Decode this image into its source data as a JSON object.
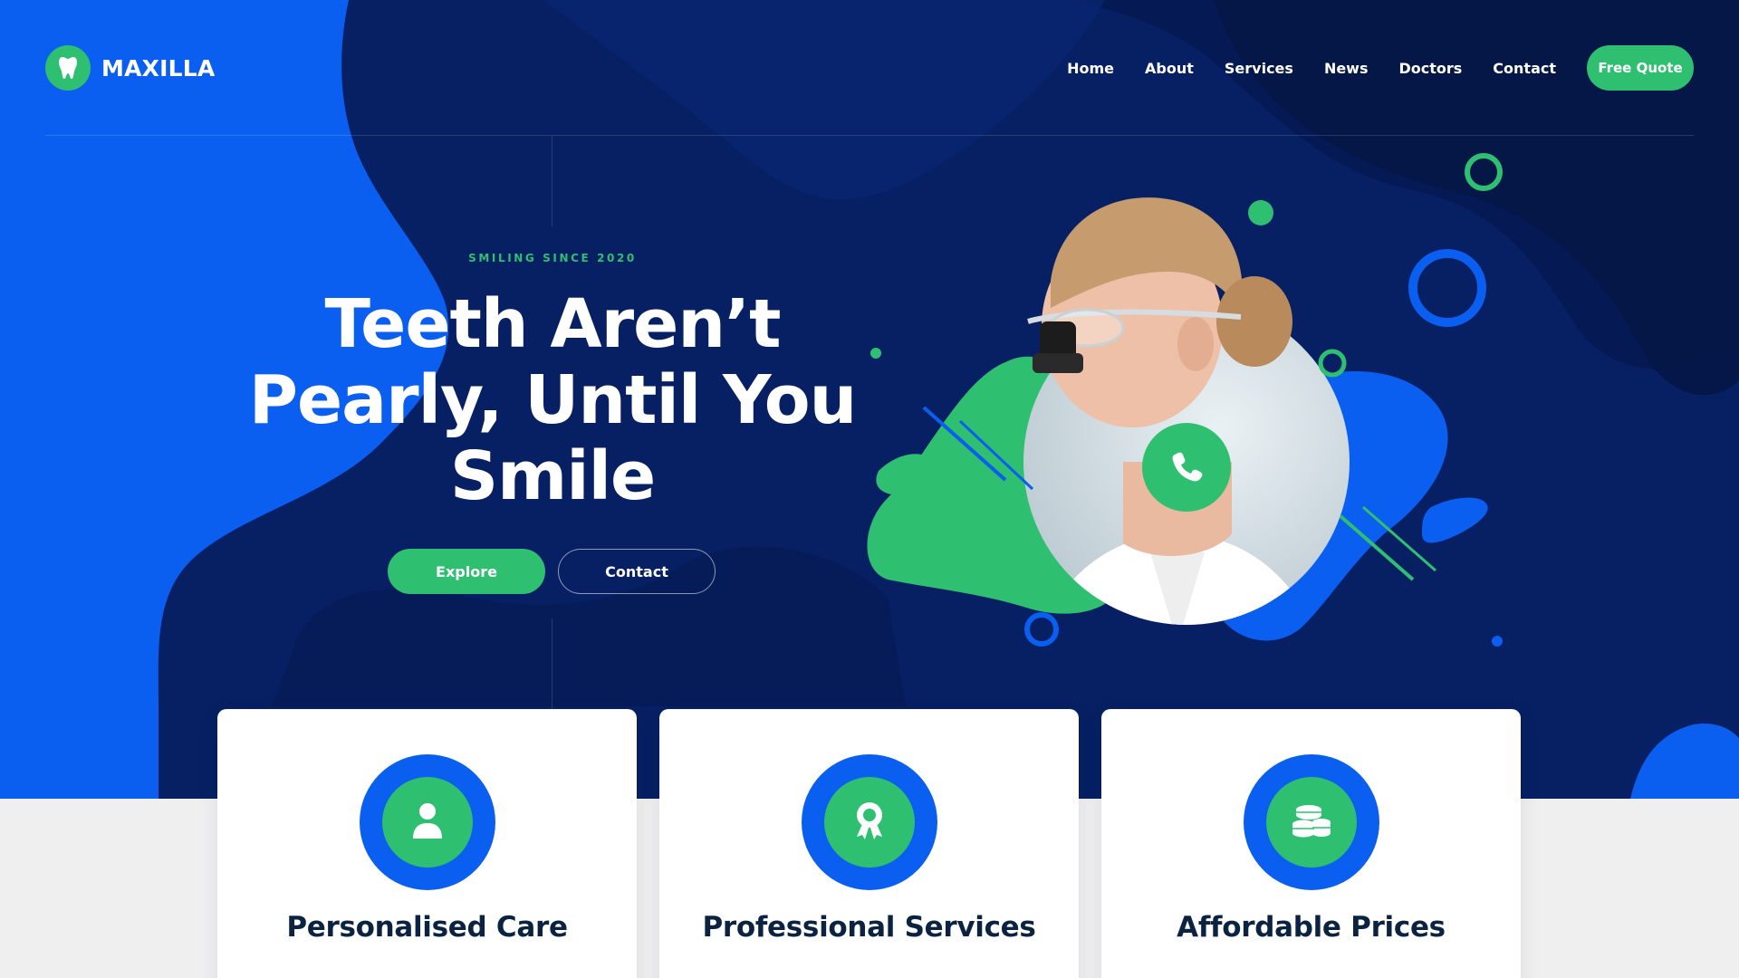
{
  "brand": {
    "name": "MAXILLA",
    "logo_icon": "tooth-icon"
  },
  "nav": {
    "items": [
      {
        "label": "Home"
      },
      {
        "label": "About"
      },
      {
        "label": "Services"
      },
      {
        "label": "News"
      },
      {
        "label": "Doctors"
      },
      {
        "label": "Contact"
      }
    ],
    "cta_label": "Free Quote"
  },
  "hero": {
    "tagline": "SMILING SINCE 2020",
    "headline_lines": [
      "Teeth Aren’t",
      "Pearly, Until You",
      "Smile"
    ],
    "buttons": {
      "explore": "Explore",
      "contact": "Contact"
    },
    "phone_icon": "phone-icon"
  },
  "features": [
    {
      "title": "Personalised Care",
      "icon": "user-icon"
    },
    {
      "title": "Professional Services",
      "icon": "award-icon"
    },
    {
      "title": "Affordable Prices",
      "icon": "coins-icon"
    }
  ],
  "colors": {
    "brand_blue": "#0a5ef0",
    "navy": "#0a2a7a",
    "green": "#2fbf71",
    "dark_text": "#0b2340",
    "light_gray": "#efefef"
  }
}
